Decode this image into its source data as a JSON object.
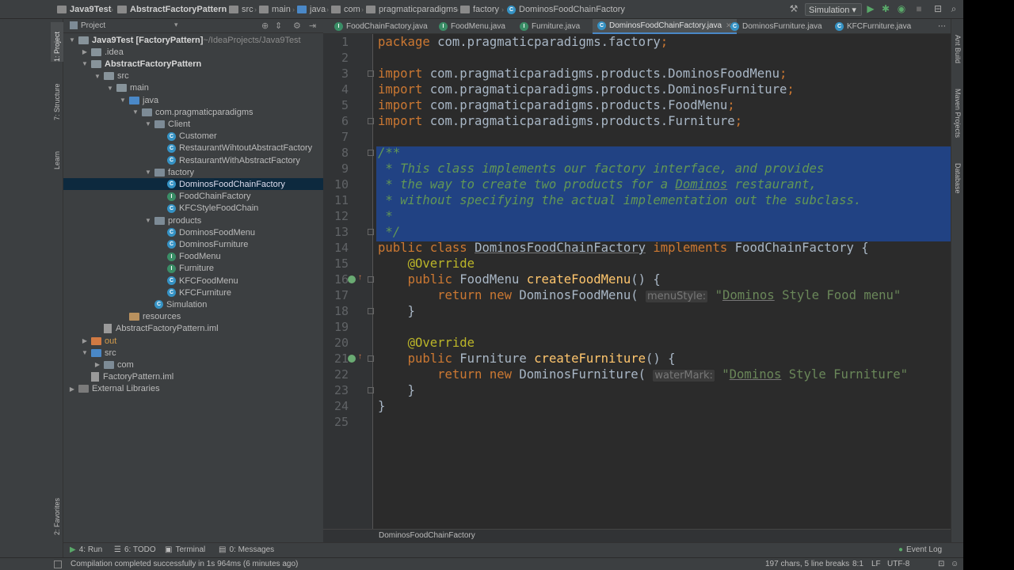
{
  "navbar": {
    "crumbs": [
      "Java9Test",
      "AbstractFactoryPattern",
      "src",
      "main",
      "java",
      "com",
      "pragmaticparadigms",
      "factory",
      "DominosFoodChainFactory"
    ],
    "run_config": "Simulation"
  },
  "sidebar": {
    "tabs": [
      "1: Project",
      "7: Structure",
      "Learn",
      "2: Favorites"
    ]
  },
  "project": {
    "title": "Project",
    "tree": [
      {
        "label": "Java9Test [FactoryPattern]",
        "suffix": " ~/IdeaProjects/Java9Test",
        "indent": 0,
        "arrow": "down",
        "icon": "folder",
        "bold": true
      },
      {
        "label": ".idea",
        "indent": 1,
        "arrow": "right",
        "icon": "folder"
      },
      {
        "label": "AbstractFactoryPattern",
        "indent": 1,
        "arrow": "down",
        "icon": "folder",
        "bold": true
      },
      {
        "label": "src",
        "indent": 2,
        "arrow": "down",
        "icon": "folder"
      },
      {
        "label": "main",
        "indent": 3,
        "arrow": "down",
        "icon": "folder"
      },
      {
        "label": "java",
        "indent": 4,
        "arrow": "down",
        "icon": "src"
      },
      {
        "label": "com.pragmaticparadigms",
        "indent": 5,
        "arrow": "down",
        "icon": "pkg"
      },
      {
        "label": "Client",
        "indent": 6,
        "arrow": "down",
        "icon": "pkg"
      },
      {
        "label": "Customer",
        "indent": 7,
        "arrow": "",
        "icon": "class"
      },
      {
        "label": "RestaurantWihtoutAbstractFactory",
        "indent": 7,
        "arrow": "",
        "icon": "class"
      },
      {
        "label": "RestaurantWithAbstractFactory",
        "indent": 7,
        "arrow": "",
        "icon": "class"
      },
      {
        "label": "factory",
        "indent": 6,
        "arrow": "down",
        "icon": "pkg"
      },
      {
        "label": "DominosFoodChainFactory",
        "indent": 7,
        "arrow": "",
        "icon": "class",
        "selected": true
      },
      {
        "label": "FoodChainFactory",
        "indent": 7,
        "arrow": "",
        "icon": "iface"
      },
      {
        "label": "KFCStyleFoodChain",
        "indent": 7,
        "arrow": "",
        "icon": "class"
      },
      {
        "label": "products",
        "indent": 6,
        "arrow": "down",
        "icon": "pkg"
      },
      {
        "label": "DominosFoodMenu",
        "indent": 7,
        "arrow": "",
        "icon": "class"
      },
      {
        "label": "DominosFurniture",
        "indent": 7,
        "arrow": "",
        "icon": "class"
      },
      {
        "label": "FoodMenu",
        "indent": 7,
        "arrow": "",
        "icon": "iface"
      },
      {
        "label": "Furniture",
        "indent": 7,
        "arrow": "",
        "icon": "iface"
      },
      {
        "label": "KFCFoodMenu",
        "indent": 7,
        "arrow": "",
        "icon": "class"
      },
      {
        "label": "KFCFurniture",
        "indent": 7,
        "arrow": "",
        "icon": "class"
      },
      {
        "label": "Simulation",
        "indent": 6,
        "arrow": "",
        "icon": "class"
      },
      {
        "label": "resources",
        "indent": 4,
        "arrow": "",
        "icon": "res"
      },
      {
        "label": "AbstractFactoryPattern.iml",
        "indent": 2,
        "arrow": "",
        "icon": "file"
      },
      {
        "label": "out",
        "indent": 1,
        "arrow": "right",
        "icon": "out",
        "excluded": true
      },
      {
        "label": "src",
        "indent": 1,
        "arrow": "down",
        "icon": "src"
      },
      {
        "label": "com",
        "indent": 2,
        "arrow": "right",
        "icon": "pkg"
      },
      {
        "label": "FactoryPattern.iml",
        "indent": 1,
        "arrow": "",
        "icon": "file"
      },
      {
        "label": "External Libraries",
        "indent": 0,
        "arrow": "right",
        "icon": "lib"
      }
    ]
  },
  "tabs": [
    {
      "label": "FoodChainFactory.java"
    },
    {
      "label": "FoodMenu.java"
    },
    {
      "label": "Furniture.java"
    },
    {
      "label": "DominosFoodChainFactory.java",
      "active": true
    },
    {
      "label": "DominosFurniture.java"
    },
    {
      "label": "KFCFurniture.java"
    }
  ],
  "editor": {
    "line_numbers": [
      "1",
      "2",
      "3",
      "4",
      "5",
      "6",
      "7",
      "8",
      "9",
      "10",
      "11",
      "12",
      "13",
      "14",
      "15",
      "16",
      "17",
      "18",
      "19",
      "20",
      "21",
      "22",
      "23",
      "24",
      "25"
    ],
    "lines": [
      [
        [
          "kw",
          "package "
        ],
        [
          "",
          "com.pragmaticparadigms.factory"
        ],
        [
          "kw",
          ";"
        ]
      ],
      [],
      [
        [
          "kw",
          "import "
        ],
        [
          "",
          "com.pragmaticparadigms.products.DominosFoodMenu"
        ],
        [
          "kw",
          ";"
        ]
      ],
      [
        [
          "kw",
          "import "
        ],
        [
          "",
          "com.pragmaticparadigms.products.DominosFurniture"
        ],
        [
          "kw",
          ";"
        ]
      ],
      [
        [
          "kw",
          "import "
        ],
        [
          "",
          "com.pragmaticparadigms.products.FoodMenu"
        ],
        [
          "kw",
          ";"
        ]
      ],
      [
        [
          "kw",
          "import "
        ],
        [
          "",
          "com.pragmaticparadigms.products.Furniture"
        ],
        [
          "kw",
          ";"
        ]
      ],
      [],
      [
        [
          "cmt",
          "/**"
        ]
      ],
      [
        [
          "cmt",
          " * This class implements our factory interface, and provides"
        ]
      ],
      [
        [
          "cmt",
          " * the way to create two products for a "
        ],
        [
          "cmtu",
          "Dominos"
        ],
        [
          "cmt",
          " restaurant,"
        ]
      ],
      [
        [
          "cmt",
          " * without specifying the actual implementation out the subclass."
        ]
      ],
      [
        [
          "cmt",
          " *"
        ]
      ],
      [
        [
          "cmt",
          " */"
        ]
      ],
      [
        [
          "kw",
          "public class "
        ],
        [
          "u",
          "DominosFoodChainFactory"
        ],
        [
          "kw",
          " implements "
        ],
        [
          "",
          "FoodChainFactory {"
        ]
      ],
      [
        [
          "",
          "    "
        ],
        [
          "ann",
          "@Override"
        ]
      ],
      [
        [
          "",
          "    "
        ],
        [
          "kw",
          "public "
        ],
        [
          "",
          "FoodMenu "
        ],
        [
          "mth",
          "createFoodMenu"
        ],
        [
          "",
          "() {"
        ]
      ],
      [
        [
          "",
          "        "
        ],
        [
          "kw",
          "return new "
        ],
        [
          "",
          "DominosFoodMenu( "
        ],
        [
          "hint",
          "menuStyle:"
        ],
        [
          "str",
          " \""
        ],
        [
          "stru",
          "Dominos"
        ],
        [
          "str",
          " Style Food menu\""
        ]
      ],
      [
        [
          "",
          "    }"
        ]
      ],
      [],
      [
        [
          "",
          "    "
        ],
        [
          "ann",
          "@Override"
        ]
      ],
      [
        [
          "",
          "    "
        ],
        [
          "kw",
          "public "
        ],
        [
          "",
          "Furniture "
        ],
        [
          "mth",
          "createFurniture"
        ],
        [
          "",
          "() {"
        ]
      ],
      [
        [
          "",
          "        "
        ],
        [
          "kw",
          "return new "
        ],
        [
          "",
          "DominosFurniture( "
        ],
        [
          "hint",
          "waterMark:"
        ],
        [
          "str",
          " \""
        ],
        [
          "stru",
          "Dominos"
        ],
        [
          "str",
          " Style Furniture\""
        ]
      ],
      [
        [
          "",
          "    }"
        ]
      ],
      [
        [
          "",
          "}"
        ]
      ],
      []
    ],
    "breadcrumb": "DominosFoodChainFactory"
  },
  "rightbar": {
    "tabs": [
      "Ant Build",
      "Maven Projects",
      "Database"
    ]
  },
  "bottombar": {
    "tabs": [
      "4: Run",
      "6: TODO",
      "Terminal",
      "0: Messages"
    ],
    "event_log": "Event Log"
  },
  "status": {
    "message": "Compilation completed successfully in 1s 964ms (6 minutes ago)",
    "chars": "197 chars, 5 line breaks",
    "position": "8:1",
    "line_sep": "LF",
    "encoding": "UTF-8"
  }
}
